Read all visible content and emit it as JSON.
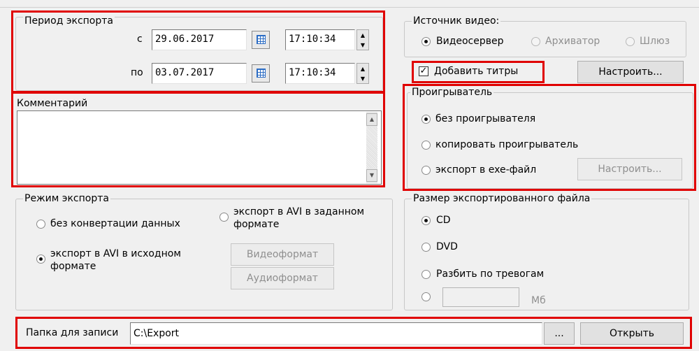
{
  "export_period": {
    "title": "Период экспорта",
    "from_label": "с",
    "from_date": "29.06.2017",
    "from_time": "17:10:34",
    "to_label": "по",
    "to_date": "03.07.2017",
    "to_time": "17:10:34"
  },
  "comment": {
    "title": "Комментарий",
    "value": ""
  },
  "video_source": {
    "title": "Источник видео:",
    "options": [
      "Видеосервер",
      "Архиватор",
      "Шлюз"
    ],
    "selected": "Видеосервер"
  },
  "captions": {
    "label": "Добавить титры",
    "checked": true,
    "configure_label": "Настроить..."
  },
  "player": {
    "title": "Проигрыватель",
    "options": [
      "без проигрывателя",
      "копировать проигрыватель",
      "экспорт в exe-файл"
    ],
    "selected": "без проигрывателя",
    "configure_label": "Настроить..."
  },
  "export_mode": {
    "title": "Режим экспорта",
    "no_convert": "без конвертации данных",
    "avi_original": "экспорт в AVI в исходном формате",
    "avi_custom": "экспорт в AVI в заданном формате",
    "selected": "экспорт в AVI в исходном формате",
    "video_format_label": "Видеоформат",
    "audio_format_label": "Аудиоформат"
  },
  "file_size": {
    "title": "Размер экспортированного файла",
    "options": [
      "CD",
      "DVD",
      "Разбить по тревогам"
    ],
    "selected": "CD",
    "custom_value": "",
    "custom_unit": "Мб"
  },
  "output_folder": {
    "label": "Папка для записи",
    "path": "C:\\Export",
    "browse_label": "...",
    "open_label": "Открыть"
  },
  "colors": {
    "highlight": "#e00000",
    "background": "#f0f0f0"
  }
}
